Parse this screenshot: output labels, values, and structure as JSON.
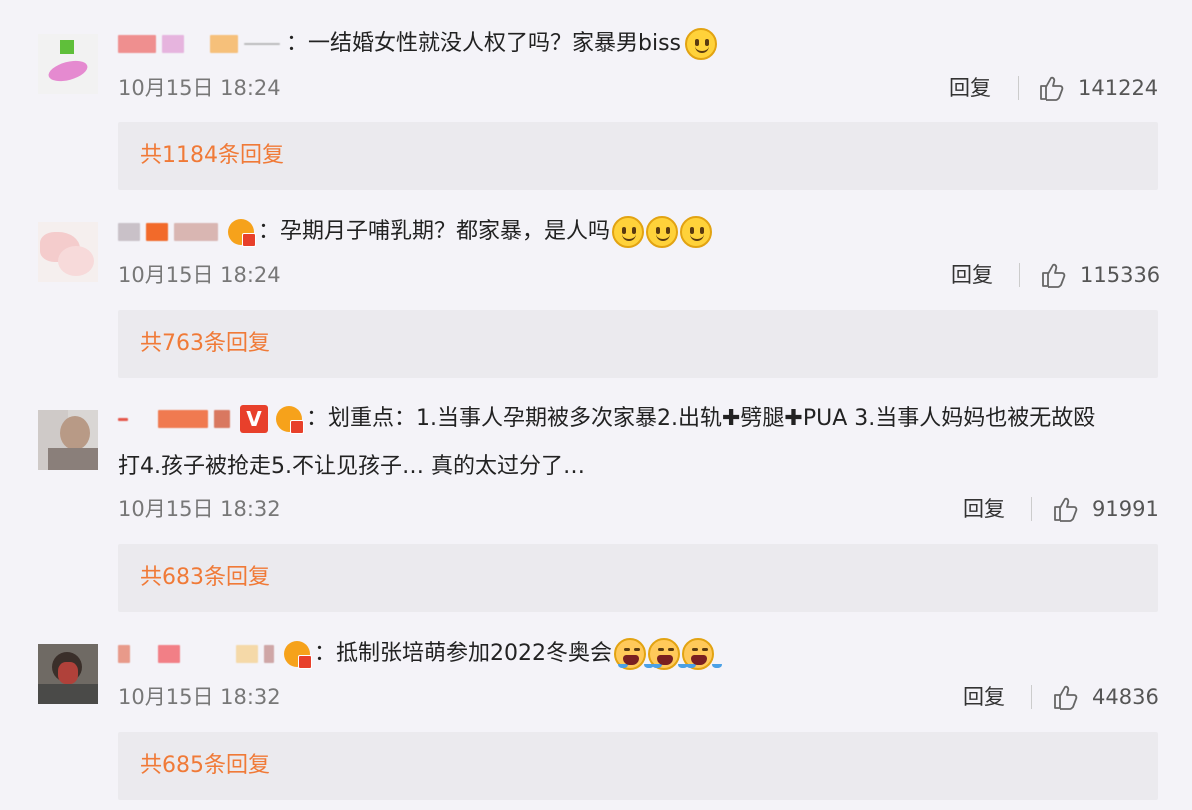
{
  "comments": [
    {
      "text": "：一结婚女性就没人权了吗？家暴男biss",
      "time": "10月15日 18:24",
      "reply_label": "回复",
      "likes": "141224",
      "replies_link": "共1184条回复"
    },
    {
      "text": "：孕期月子哺乳期？都家暴，是人吗",
      "time": "10月15日 18:24",
      "reply_label": "回复",
      "likes": "115336",
      "replies_link": "共763条回复"
    },
    {
      "text": "：划重点：1.当事人孕期被多次家暴2.出轨✚劈腿✚PUA 3.当事人妈妈也被无故殴",
      "text_line2": "打4.孩子被抢走5.不让见孩子… 真的太过分了…",
      "time": "10月15日 18:32",
      "reply_label": "回复",
      "likes": "91991",
      "replies_link": "共683条回复"
    },
    {
      "text": "：抵制张培萌参加2022冬奥会",
      "time": "10月15日 18:32",
      "reply_label": "回复",
      "likes": "44836",
      "replies_link": "共685条回复"
    }
  ],
  "icons": {
    "like": "thumbs-up-icon",
    "emoji_smile": "smile-emoji-icon",
    "emoji_cry": "crying-emoji-icon",
    "member_badge": "crown-badge-icon",
    "verified_badge": "v-verified-badge"
  },
  "verified_badge_text": "V",
  "colors": {
    "background": "#f4f3f8",
    "replies_box": "#ebeaee",
    "accent_orange": "#f07a37",
    "time_grey": "#777777"
  }
}
